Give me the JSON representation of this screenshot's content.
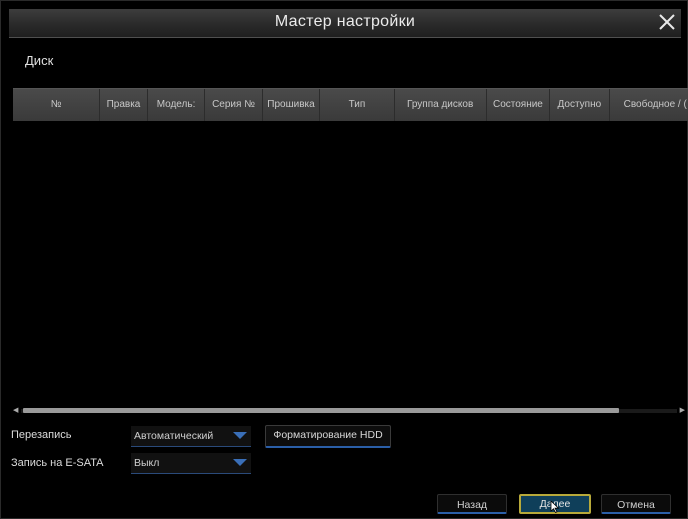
{
  "window": {
    "title": "Мастер настройки"
  },
  "section": {
    "title": "Диск"
  },
  "table": {
    "columns": [
      "№",
      "Правка",
      "Модель:",
      "Серия №",
      "Прошивка",
      "Тип",
      "Группа дисков",
      "Состояние",
      "Доступно",
      "Свободное / ("
    ],
    "rows": []
  },
  "settings": {
    "overwrite_label": "Перезапись",
    "overwrite_value": "Автоматический",
    "esata_label": "Запись на  E-SATA",
    "esata_value": "Выкл",
    "format_button": "Форматирование HDD"
  },
  "footer": {
    "back_label": "Назад",
    "next_label": "Далее",
    "cancel_label": "Отмена"
  },
  "colors": {
    "accent": "#2b5fa8",
    "focus_border": "#b7a93a",
    "header_bg": "#3a3a3a"
  }
}
